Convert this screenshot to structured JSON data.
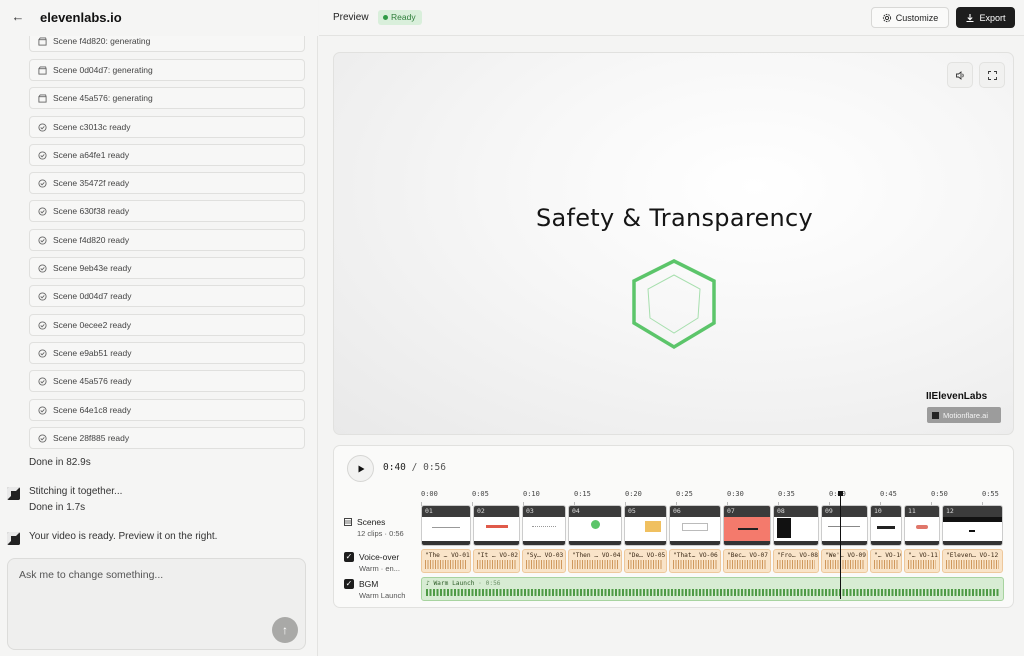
{
  "app": {
    "brand": "elevenlabs.io"
  },
  "left": {
    "scenes": [
      {
        "label": "Scene f4d820: generating",
        "state": "generating"
      },
      {
        "label": "Scene 0d04d7: generating",
        "state": "generating"
      },
      {
        "label": "Scene 45a576: generating",
        "state": "generating"
      },
      {
        "label": "Scene c3013c ready",
        "state": "ready"
      },
      {
        "label": "Scene a64fe1 ready",
        "state": "ready"
      },
      {
        "label": "Scene 35472f ready",
        "state": "ready"
      },
      {
        "label": "Scene 630f38 ready",
        "state": "ready"
      },
      {
        "label": "Scene f4d820 ready",
        "state": "ready"
      },
      {
        "label": "Scene 9eb43e ready",
        "state": "ready"
      },
      {
        "label": "Scene 0d04d7 ready",
        "state": "ready"
      },
      {
        "label": "Scene 0ecee2 ready",
        "state": "ready"
      },
      {
        "label": "Scene e9ab51 ready",
        "state": "ready"
      },
      {
        "label": "Scene 45a576 ready",
        "state": "ready"
      },
      {
        "label": "Scene 64e1c8 ready",
        "state": "ready"
      },
      {
        "label": "Scene 28f885 ready",
        "state": "ready"
      }
    ],
    "done1": "Done in 82.9s",
    "stitching": "Stitching it together...",
    "done2": "Done in 1.7s",
    "ready_msg": "Your video is ready. Preview it on the right.",
    "chat_placeholder": "Ask me to change something..."
  },
  "header": {
    "title": "Preview",
    "status": "Ready",
    "customize": "Customize",
    "export": "Export"
  },
  "video": {
    "title": "Safety & Transparency",
    "watermark_brand": "IIElevenLabs",
    "watermark_badge": "Motionflare.ai"
  },
  "timeline": {
    "current": "0:40",
    "separator": "/",
    "total": "0:56",
    "ticks": [
      "0:00",
      "0:05",
      "0:10",
      "0:15",
      "0:20",
      "0:25",
      "0:30",
      "0:35",
      "0:40",
      "0:45",
      "0:50",
      "0:55"
    ],
    "scenes_label": "Scenes",
    "scenes_sub": "12 clips · 0:56",
    "clips": [
      "01",
      "02",
      "03",
      "04",
      "05",
      "06",
      "07",
      "08",
      "09",
      "10",
      "11",
      "12"
    ],
    "vo_label": "Voice-over",
    "vo_sub": "Warm · en...",
    "vo": [
      {
        "text": "\"The …",
        "id": "VO-01"
      },
      {
        "text": "\"It …",
        "id": "VO-02"
      },
      {
        "text": "\"Sy…",
        "id": "VO-03"
      },
      {
        "text": "\"Then …",
        "id": "VO-04"
      },
      {
        "text": "\"De…",
        "id": "VO-05"
      },
      {
        "text": "\"That…",
        "id": "VO-06"
      },
      {
        "text": "\"Bec…",
        "id": "VO-07"
      },
      {
        "text": "\"Fro…",
        "id": "VO-08"
      },
      {
        "text": "\"We'…",
        "id": "VO-09"
      },
      {
        "text": "\"…",
        "id": "VO-10"
      },
      {
        "text": "\"…",
        "id": "VO-11"
      },
      {
        "text": "\"Eleven…",
        "id": "VO-12"
      }
    ],
    "bgm_label": "BGM",
    "bgm_sub": "Warm Launch",
    "bgm_track": "♪ Warm Launch",
    "bgm_len": "· 0:56"
  },
  "colors": {
    "accent": "#5cc56a",
    "vo": "#f9e4c9",
    "bgm": "#d7ecd3",
    "clip7": "#f47a6c"
  }
}
